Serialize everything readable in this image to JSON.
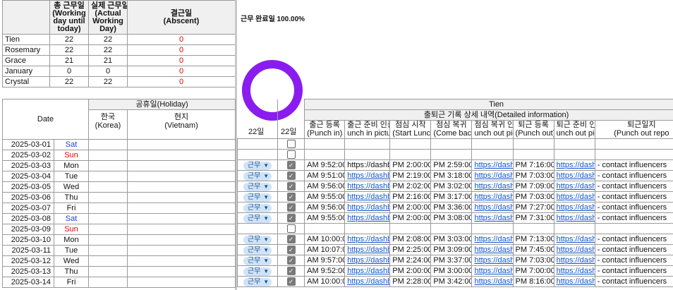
{
  "summary": {
    "headers": [
      {
        "l1": "총 근무일",
        "l2": "(Working",
        "l3": "day until",
        "l4": "today)"
      },
      {
        "l1": "실제 근무일",
        "l2": "(Actual",
        "l3": "Working",
        "l4": "Day)"
      },
      {
        "l1": "결근일",
        "l2": "(Abscent)",
        "l3": "",
        "l4": ""
      }
    ],
    "rows": [
      {
        "name": "Tien",
        "total": "22",
        "actual": "22",
        "absent": "0"
      },
      {
        "name": "Rosemary",
        "total": "22",
        "actual": "22",
        "absent": "0"
      },
      {
        "name": "Grace",
        "total": "21",
        "actual": "21",
        "absent": "0"
      },
      {
        "name": "January",
        "total": "0",
        "actual": "0",
        "absent": "0"
      },
      {
        "name": "Crystal",
        "total": "22",
        "actual": "22",
        "absent": "0"
      }
    ]
  },
  "completion_label": "근무 완료일 100.00%",
  "completion_ratio": 1.0,
  "ring_color": "#8a1cf0",
  "left_table": {
    "date_header": "Date",
    "holiday_header": "공휴일(Holiday)",
    "korea_l1": "한국",
    "korea_l2": "(Korea)",
    "vietnam_l1": "현지",
    "vietnam_l2": "(Vietnam)"
  },
  "right_table": {
    "person": "Tien",
    "detail_header": "출퇴근 기록 상세 내역(Detailed information)",
    "count1": "22일",
    "count2": "22일",
    "col_headers": [
      {
        "l1": "출근 등록",
        "l2": "(Punch in)"
      },
      {
        "l1": "출근 준비 인증",
        "l2": "unch in pictur"
      },
      {
        "l1": "점심 시작",
        "l2": "(Start Lunch)"
      },
      {
        "l1": "점심 복귀",
        "l2": "(Come back)"
      },
      {
        "l1": "점심 복귀 인증",
        "l2": "unch out pictu"
      },
      {
        "l1": "퇴근 등록",
        "l2": "(Punch out)"
      },
      {
        "l1": "퇴근 준비 인증",
        "l2": "unch out pictu"
      },
      {
        "l1": "퇴근일지",
        "l2": "(Punch out repo"
      }
    ]
  },
  "status_chip": "근무",
  "rows": [
    {
      "date": "2025-03-01",
      "day": "Sat",
      "type": "sat",
      "work": false,
      "status": "",
      "punch_in": "",
      "pic_in": "",
      "lunch": "",
      "back": "",
      "pic_back": "",
      "out": "",
      "pic_out": "",
      "report": ""
    },
    {
      "date": "2025-03-02",
      "day": "Sun",
      "type": "sun",
      "work": false,
      "status": "",
      "punch_in": "",
      "pic_in": "",
      "lunch": "",
      "back": "",
      "pic_back": "",
      "out": "",
      "pic_out": "",
      "report": ""
    },
    {
      "date": "2025-03-03",
      "day": "Mon",
      "type": "wd",
      "work": true,
      "status": "근무",
      "punch_in": "AM 9:52:00",
      "pic_in": "https://dashb",
      "lunch": "PM 2:00:00",
      "back": "PM 2:59:00",
      "pic_back": "https://dashb",
      "out": "PM 7:16:00",
      "pic_out": "https://dashb",
      "report": "- contact influencers"
    },
    {
      "date": "2025-03-04",
      "day": "Tue",
      "type": "wd",
      "work": true,
      "status": "근무",
      "punch_in": "AM 9:51:00",
      "pic_in": "https://dashb",
      "lunch": "PM 2:19:00",
      "back": "PM 3:18:00",
      "pic_back": "https://dashb",
      "out": "PM 7:03:00",
      "pic_out": "https://dashb",
      "report": "- contact influencers"
    },
    {
      "date": "2025-03-05",
      "day": "Wed",
      "type": "wd",
      "work": true,
      "status": "근무",
      "punch_in": "AM 9:56:00",
      "pic_in": "https://dashb",
      "lunch": "PM 2:02:00",
      "back": "PM 3:02:00",
      "pic_back": "https://dashb",
      "out": "PM 7:09:00",
      "pic_out": "https://dashb",
      "report": "- contact influencers"
    },
    {
      "date": "2025-03-06",
      "day": "Thu",
      "type": "wd",
      "work": true,
      "status": "근무",
      "punch_in": "AM 9:55:00",
      "pic_in": "https://dashb",
      "lunch": "PM 2:16:00",
      "back": "PM 3:17:00",
      "pic_back": "https://dashb",
      "out": "PM 7:03:00",
      "pic_out": "https://dashb",
      "report": "- contact influencers"
    },
    {
      "date": "2025-03-07",
      "day": "Fri",
      "type": "wd",
      "work": true,
      "status": "근무",
      "punch_in": "AM 9:56:00",
      "pic_in": "https://dashb",
      "lunch": "PM 2:00:00",
      "back": "PM 3:36:00",
      "pic_back": "https://dashb",
      "out": "PM 7:27:00",
      "pic_out": "https://dashb",
      "report": "- contact influencers"
    },
    {
      "date": "2025-03-08",
      "day": "Sat",
      "type": "sat",
      "work": true,
      "status": "근무",
      "punch_in": "AM 9:55:00",
      "pic_in": "https://dashb",
      "lunch": "PM 2:00:00",
      "back": "PM 3:08:00",
      "pic_back": "https://dashb",
      "out": "PM 7:31:00",
      "pic_out": "https://dashb",
      "report": "- contact influencers"
    },
    {
      "date": "2025-03-09",
      "day": "Sun",
      "type": "sun",
      "work": false,
      "status": "",
      "punch_in": "",
      "pic_in": "",
      "lunch": "",
      "back": "",
      "pic_back": "",
      "out": "",
      "pic_out": "",
      "report": ""
    },
    {
      "date": "2025-03-10",
      "day": "Mon",
      "type": "wd",
      "work": true,
      "status": "근무",
      "punch_in": "AM 10:00:00",
      "pic_in": "https://dashb",
      "lunch": "PM 2:08:00",
      "back": "PM 3:03:00",
      "pic_back": "https://dashb",
      "out": "PM 7:13:00",
      "pic_out": "https://dashb",
      "report": "- contact influencers"
    },
    {
      "date": "2025-03-11",
      "day": "Tue",
      "type": "wd",
      "work": true,
      "status": "근무",
      "punch_in": "AM 10:07:00",
      "pic_in": "https://dashb",
      "lunch": "PM 2:25:00",
      "back": "PM 3:09:00",
      "pic_back": "https://dashb",
      "out": "PM 7:45:00",
      "pic_out": "https://dashb",
      "report": "- contact influencers"
    },
    {
      "date": "2025-03-12",
      "day": "Wed",
      "type": "wd",
      "work": true,
      "status": "근무",
      "punch_in": "AM 9:57:00",
      "pic_in": "https://dashb",
      "lunch": "PM 2:24:00",
      "back": "PM 3:37:00",
      "pic_back": "https://dashb",
      "out": "PM 7:03:00",
      "pic_out": "https://dashb",
      "report": "- contact influencers"
    },
    {
      "date": "2025-03-13",
      "day": "Thu",
      "type": "wd",
      "work": true,
      "status": "근무",
      "punch_in": "AM 9:52:00",
      "pic_in": "https://dashb",
      "lunch": "PM 2:00:00",
      "back": "PM 3:00:00",
      "pic_back": "https://dashb",
      "out": "PM 7:00:00",
      "pic_out": "https://dashb",
      "report": "- contact influencers"
    },
    {
      "date": "2025-03-14",
      "day": "Fri",
      "type": "wd",
      "work": true,
      "status": "근무",
      "punch_in": "AM 10:00:00",
      "pic_in": "https://dashb",
      "lunch": "PM 2:28:00",
      "back": "PM 3:42:00",
      "pic_back": "https://dashb",
      "out": "PM 8:16:00",
      "pic_out": "https://dashb",
      "report": "- contact influencers"
    }
  ]
}
